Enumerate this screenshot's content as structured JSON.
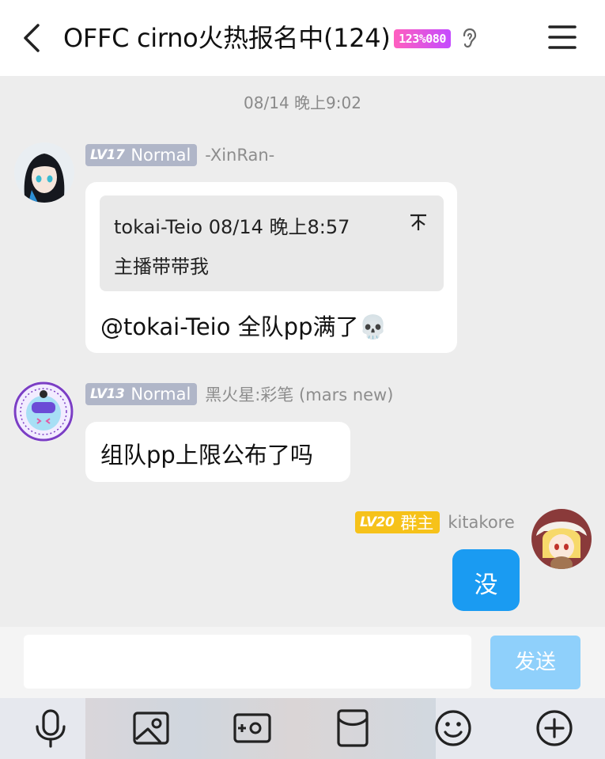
{
  "header": {
    "title": "OFFC cirno火热报名中(124)",
    "tag_badge": "123%080",
    "back_icon": "chevron-left-icon",
    "ear_icon": "ear-icon",
    "menu_icon": "hamburger-menu-icon"
  },
  "timestamp": "08/14 晚上9:02",
  "messages": [
    {
      "level_num": "LV17",
      "level_title": "Normal",
      "username": "-XinRan-",
      "quote": {
        "header": "tokai-Teio 08/14 晚上8:57",
        "text": "主播带带我"
      },
      "text": "@tokai-Teio 全队pp满了💀"
    },
    {
      "level_num": "LV13",
      "level_title": "Normal",
      "username": "黑火星:彩笔 (mars new)",
      "text": "组队pp上限公布了吗"
    },
    {
      "level_num": "LV20",
      "level_title": "群主",
      "username": "kitakore",
      "text": "没"
    }
  ],
  "input": {
    "placeholder": "",
    "send_label": "发送"
  },
  "toolbar": [
    "microphone-icon",
    "image-icon",
    "camera-icon",
    "red-packet-icon",
    "emoji-icon",
    "plus-icon"
  ],
  "colors": {
    "accent": "#1a9bf2",
    "send_disabled": "#8fd0fb",
    "owner_badge": "#f6c21a",
    "level_badge": "#b0b6c8"
  }
}
